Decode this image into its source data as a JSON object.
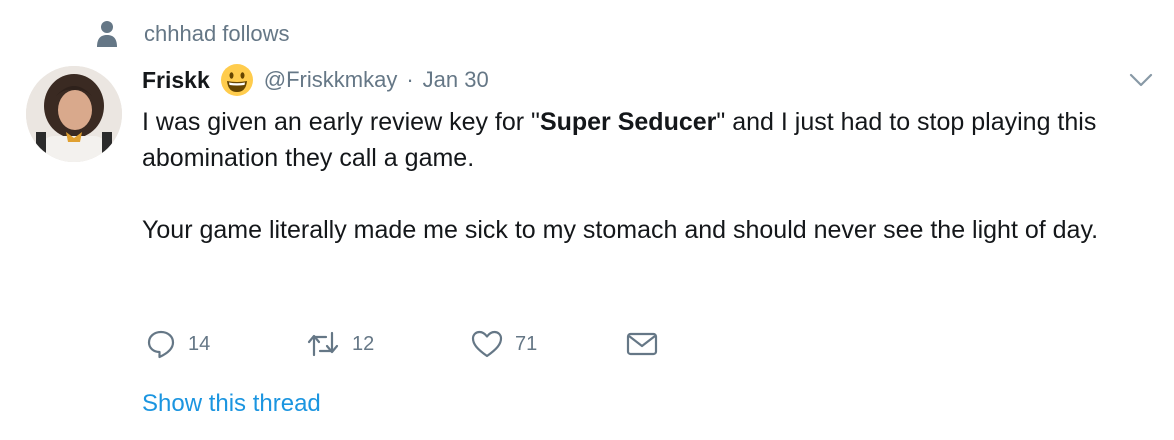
{
  "social_context": {
    "icon": "person-icon",
    "text": "chhhad follows"
  },
  "tweet": {
    "display_name": "Friskk",
    "emoji": "smiling-face-emoji",
    "handle": "@Friskkmkay",
    "separator": "·",
    "date": "Jan 30",
    "text_part1": "I was given an early review key for \"",
    "text_bold": "Super Seducer",
    "text_part2": "\" and I just had to stop playing this abomination they call a game.",
    "text_paragraph2": "Your game literally made me sick to my stomach and should never see the light of day."
  },
  "actions": {
    "reply_count": "14",
    "retweet_count": "12",
    "like_count": "71"
  },
  "show_thread_label": "Show this thread",
  "colors": {
    "secondary_text": "#657786",
    "link": "#1b95e0",
    "primary_text": "#14171a"
  }
}
